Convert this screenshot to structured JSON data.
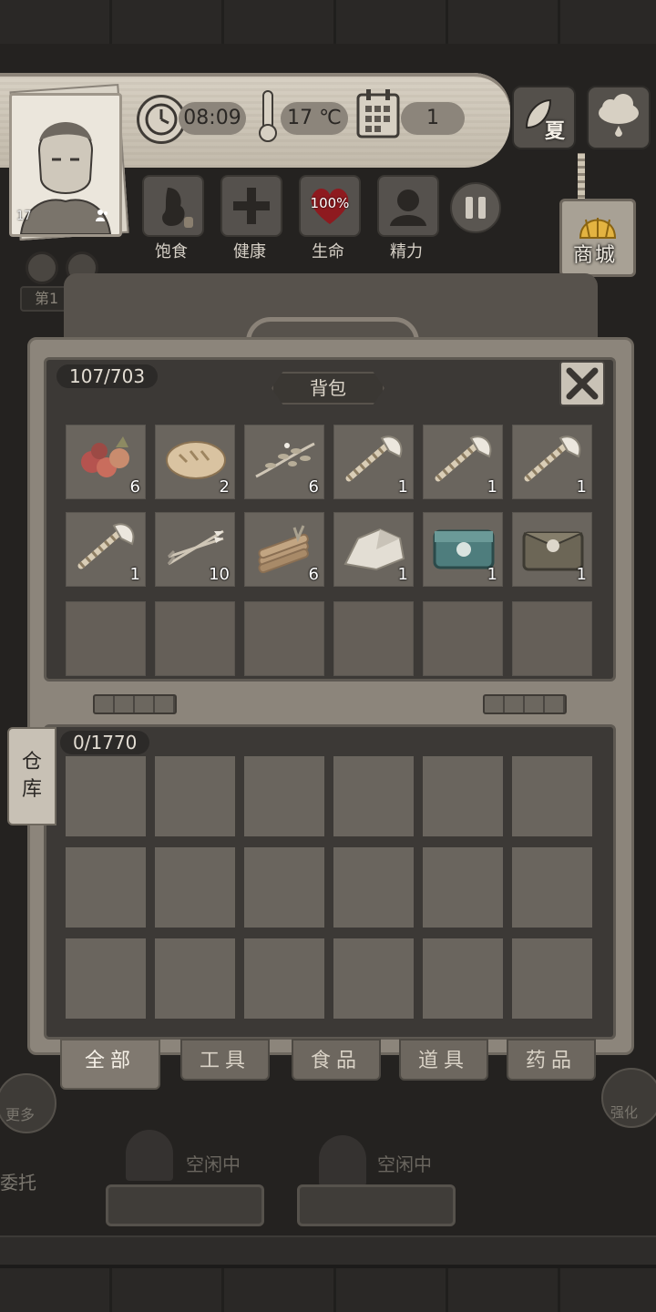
{
  "hud": {
    "time": "08:09",
    "temperature": "17 ℃",
    "day": "1",
    "season": "夏",
    "level": "17",
    "stats": [
      {
        "label": "饱食",
        "icon": "stomach-icon"
      },
      {
        "label": "健康",
        "icon": "plus-icon"
      },
      {
        "label": "生命",
        "icon": "heart-icon",
        "value": "100%"
      },
      {
        "label": "精力",
        "icon": "person-icon"
      }
    ],
    "shop_label": "商城",
    "bg_partial_label": "第1"
  },
  "backpack": {
    "title": "背包",
    "capacity": "107/703",
    "items": [
      {
        "icon": "berries-icon",
        "qty": "6"
      },
      {
        "icon": "bread-icon",
        "qty": "2"
      },
      {
        "icon": "herb-branch-icon",
        "qty": "6"
      },
      {
        "icon": "axe-icon",
        "qty": "1"
      },
      {
        "icon": "axe-icon",
        "qty": "1"
      },
      {
        "icon": "axe-icon",
        "qty": "1"
      },
      {
        "icon": "axe-icon",
        "qty": "1"
      },
      {
        "icon": "arrows-icon",
        "qty": "10"
      },
      {
        "icon": "firewood-icon",
        "qty": "6"
      },
      {
        "icon": "stone-icon",
        "qty": "1"
      },
      {
        "icon": "teal-chest-icon",
        "qty": "1"
      },
      {
        "icon": "pouch-icon",
        "qty": "1"
      }
    ]
  },
  "warehouse": {
    "tab_label": "仓库",
    "capacity": "0/1770"
  },
  "tabs": [
    "全部",
    "工具",
    "食品",
    "道具",
    "药品"
  ],
  "active_tab": 0,
  "background": {
    "workers": [
      {
        "status": "空闲中"
      },
      {
        "status": "空闲中"
      }
    ],
    "left_buttons": [
      "更多",
      "委托"
    ],
    "right_button": "强化"
  }
}
